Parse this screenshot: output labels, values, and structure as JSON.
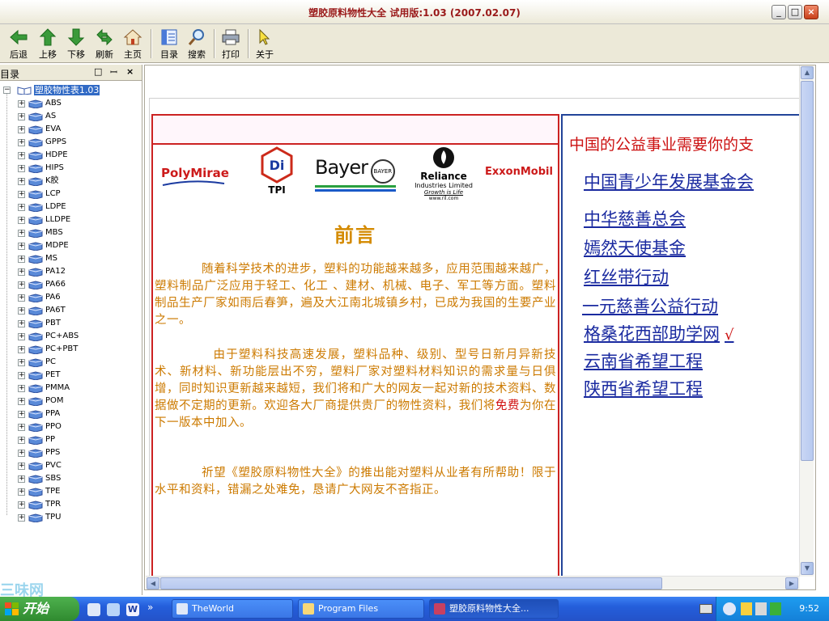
{
  "window": {
    "title": "塑胶原料物性大全 试用版:1.03 (2007.02.07)",
    "minimize": "_",
    "maximize": "□",
    "close": "×"
  },
  "toolbar": {
    "back": "后退",
    "up": "上移",
    "down": "下移",
    "refresh": "刷新",
    "home": "主页",
    "contents": "目录",
    "search": "搜索",
    "print": "打印",
    "about": "关于"
  },
  "tree": {
    "header": "目录",
    "header_btn_1": "□",
    "header_btn_2": "ꟷ",
    "header_close": "×",
    "root_label": "塑胶物性表1.03",
    "items": [
      "ABS",
      "AS",
      "EVA",
      "GPPS",
      "HDPE",
      "HIPS",
      "K胶",
      "LCP",
      "LDPE",
      "LLDPE",
      "MBS",
      "MDPE",
      "MS",
      "PA12",
      "PA66",
      "PA6",
      "PA6T",
      "PBT",
      "PC+ABS",
      "PC+PBT",
      "PC",
      "PET",
      "PMMA",
      "POM",
      "PPA",
      "PPO",
      "PP",
      "PPS",
      "PVC",
      "SBS",
      "TPE",
      "TPR",
      "TPU"
    ]
  },
  "logos": {
    "polymirae": "PolyMirae",
    "tpi": "TPI",
    "bayer": "Bayer",
    "bayer_seal": "BAYER",
    "reliance": "Reliance",
    "reliance_sub": "Industries Limited",
    "reliance_tag": "Growth is Life",
    "reliance_url": "www.ril.com",
    "exxon": "ExxonMobil"
  },
  "preface": {
    "title": "前言",
    "p1": "随着科学技术的进步，塑料的功能越来越多，应用范围越来越广，塑料制品广泛应用于轻工、化工 、建材、机械、电子、军工等方面。塑料制品生产厂家如雨后春笋，遍及大江南北城镇乡村，已成为我国的生要产业之一。",
    "p2_a": "由于塑料科技高速发展，塑料品种、级别、型号日新月异新技术、新材料、新功能层出不穷，塑料厂家对塑料材料知识的需求量与日俱增，同时知识更新越来越短，我们将和广大的网友一起对新的技术资料、数据做不定期的更新。欢迎各大厂商提供贵厂的物性资料，我们将",
    "p2_free": "免费",
    "p2_b": "为你在下一版本中加入。",
    "p3": "祈望《塑胶原料物性大全》的推出能对塑料从业者有所帮助！限于水平和资料，错漏之处难免，恳请广大网友不吝指正。"
  },
  "charity": {
    "slogan": "中国的公益事业需要你的支",
    "links": [
      "中国青少年发展基金会",
      "中华慈善总会",
      "嫣然天使基金",
      "红丝带行动",
      "一元慈善公益行动",
      "格桑花西部助学网",
      "云南省希望工程",
      "陕西省希望工程"
    ],
    "checkmark": "√"
  },
  "taskbar": {
    "start": "开始",
    "tasks": [
      "TheWorld",
      "Program Files",
      "塑胶原料物性大全..."
    ],
    "clock": "9:52",
    "more": "»"
  },
  "watermark": "三味网"
}
